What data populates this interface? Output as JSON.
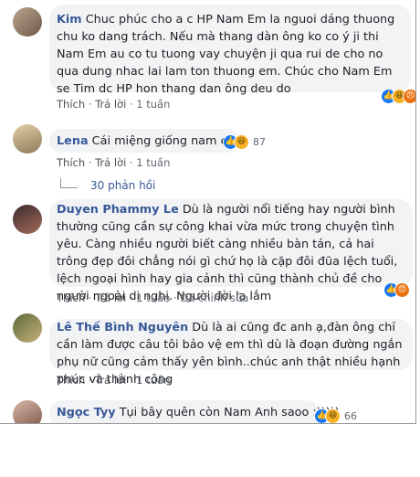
{
  "comments": [
    {
      "name": "Kim",
      "text": "Chuc phúc cho a c HP Nam Em la nguoi dáng thuong chu ko dang trách. Nếu mà thang dàn ông ko co ý ji thi Nam Em au co tu tuong vay chuyện ji qua rui de cho no qua dung nhac lai lam ton thuong em. Chúc cho Nam Em se Tim dc HP hon thang dan ông deu do",
      "like": "Thích",
      "reply": "Trả lời",
      "time": "1 tuần"
    },
    {
      "name": "Lena",
      "text": "Cái miệng giống nam em",
      "reaction_count": "87",
      "like": "Thích",
      "reply": "Trả lời",
      "time": "1 tuần",
      "replies_label": "30 phản hồi"
    },
    {
      "name": "Duyen Phammy Le",
      "text": "Dù là người nổi tiếng hay người bình thường cũng cần sự công khai vừa mức trong chuyện tình yêu. Càng nhiều người biết càng nhiều bàn tán, cả hai trông đẹp đôi chẳng nói gì chứ họ là cặp đôi đũa lệch tuổi, lệch ngoại hình hay gia cảnh thì cũng thành chủ đề cho người ngoài dị nghị. Người đời lạ lắm",
      "like": "Thích",
      "reply": "Trả lời",
      "time": "1 tuần",
      "edited": "Đã chỉnh sửa"
    },
    {
      "name": "Lê Thế Bình Nguyên",
      "text": "Dù là ai cũng đc anh ạ,đàn ông chỉ cần làm được câu tôi bảo vệ em thì dù là đoạn đường ngắn phụ nữ cũng cảm thấy yên bình..chúc anh thật nhiều hạnh phúc và thành công",
      "like": "Thích",
      "reply": "Trả lời",
      "time": "1 tuần"
    },
    {
      "name": "Ngọc Tyy",
      "text": "Tụi bây quên còn Nam Anh saoo :)))))",
      "reaction_count": "66"
    }
  ],
  "colors": {
    "name": "#385898",
    "bubble": "#f2f3f5",
    "meta": "#606770",
    "like": "#1877f2",
    "haha": "#f7b125",
    "angry": "#e9710f"
  }
}
